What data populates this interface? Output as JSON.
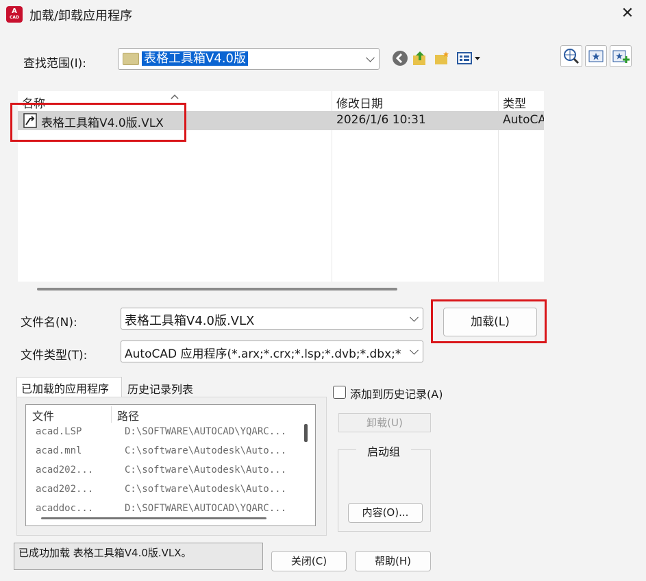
{
  "window": {
    "title": "加载/卸载应用程序",
    "app_icon_text": "A",
    "app_icon_sub": "CAD"
  },
  "lookin": {
    "label": "查找范围(I):",
    "value": "表格工具箱V4.0版"
  },
  "toolbar": {
    "icons": [
      "back-icon",
      "up-folder-icon",
      "new-folder-icon",
      "views-icon"
    ],
    "right_icons": [
      "web-search-icon",
      "favorites-icon",
      "add-favorites-icon"
    ]
  },
  "filelist": {
    "columns": [
      "名称",
      "修改日期",
      "类型"
    ],
    "rows": [
      {
        "name": "表格工具箱V4.0版.VLX",
        "date": "2026/1/6 10:31",
        "type": "AutoCA"
      }
    ]
  },
  "filename": {
    "label": "文件名(N):",
    "value": "表格工具箱V4.0版.VLX"
  },
  "filetype": {
    "label": "文件类型(T):",
    "value": "AutoCAD 应用程序(*.arx;*.crx;*.lsp;*.dvb;*.dbx;*.v"
  },
  "load_button": "加载(L)",
  "tabs": [
    "已加载的应用程序",
    "历史记录列表"
  ],
  "loaded": {
    "columns": [
      "文件",
      "路径"
    ],
    "rows": [
      {
        "file": "acad.LSP",
        "path": "D:\\SOFTWARE\\AUTOCAD\\YQARC..."
      },
      {
        "file": "acad.mnl",
        "path": "C:\\software\\Autodesk\\Auto..."
      },
      {
        "file": "acad202...",
        "path": "C:\\software\\Autodesk\\Auto..."
      },
      {
        "file": "acad202...",
        "path": "C:\\software\\Autodesk\\Auto..."
      },
      {
        "file": "acaddoc...",
        "path": "D:\\SOFTWARE\\AUTOCAD\\YQARC..."
      }
    ]
  },
  "history_checkbox": "添加到历史记录(A)",
  "unload_button": "卸载(U)",
  "startup_group": {
    "label": "启动组",
    "contents_button": "内容(O)..."
  },
  "status": "已成功加载 表格工具箱V4.0版.VLX。",
  "close_button": "关闭(C)",
  "help_button": "帮助(H)",
  "colors": {
    "accent": "#0a64d2",
    "highlight_box": "#d9161a"
  }
}
